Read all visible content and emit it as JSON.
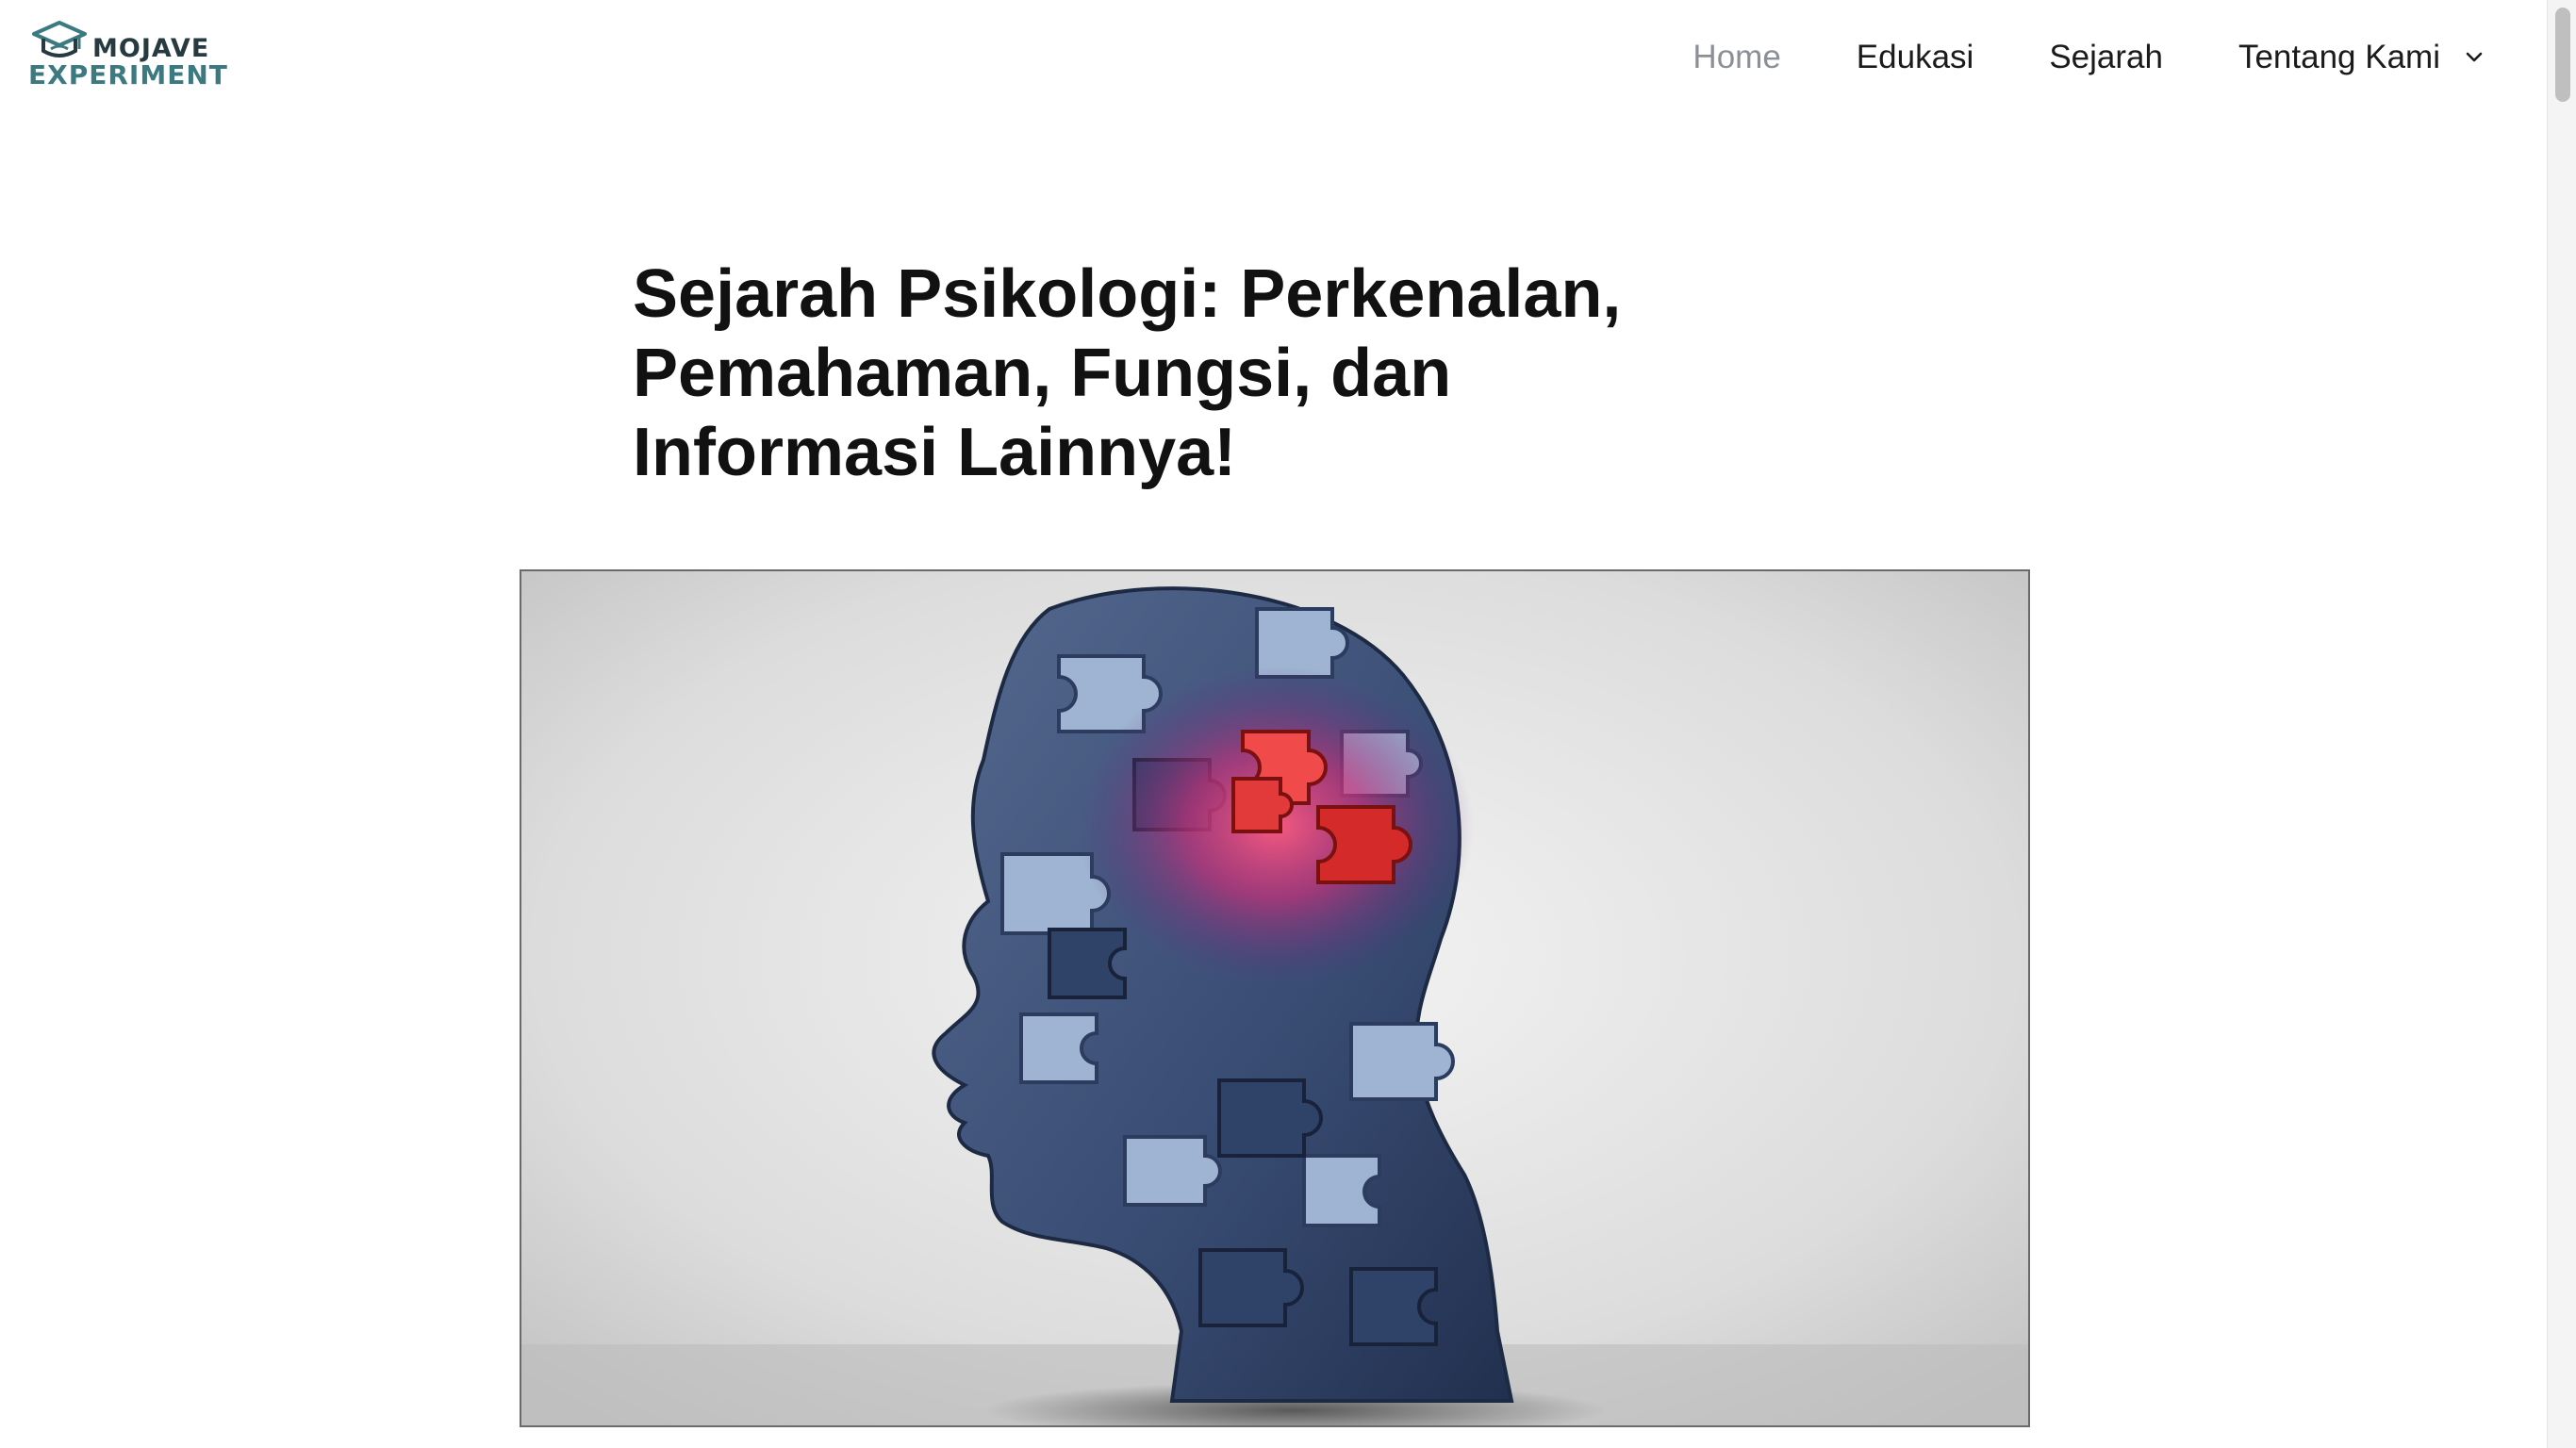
{
  "site": {
    "logo_line1": "MOJAVE",
    "logo_line2": "EXPERIMENT"
  },
  "nav": {
    "items": [
      {
        "label": "Home",
        "current": true
      },
      {
        "label": "Edukasi",
        "current": false
      },
      {
        "label": "Sejarah",
        "current": false
      },
      {
        "label": "Tentang Kami",
        "current": false,
        "has_submenu": true
      }
    ]
  },
  "article": {
    "title": "Sejarah Psikologi: Perkenalan, Pemahaman, Fungsi, dan Informasi Lainnya!"
  },
  "icons": {
    "logo": "graduation-cap-icon",
    "submenu": "chevron-down-icon"
  },
  "colors": {
    "logo_dark": "#263a40",
    "logo_teal": "#3b7a80",
    "nav_current": "#8b8f96",
    "text": "#111111",
    "puzzle_blue": "#3f5680",
    "puzzle_red": "#e23a3a",
    "glow_pink": "#e0407a"
  }
}
